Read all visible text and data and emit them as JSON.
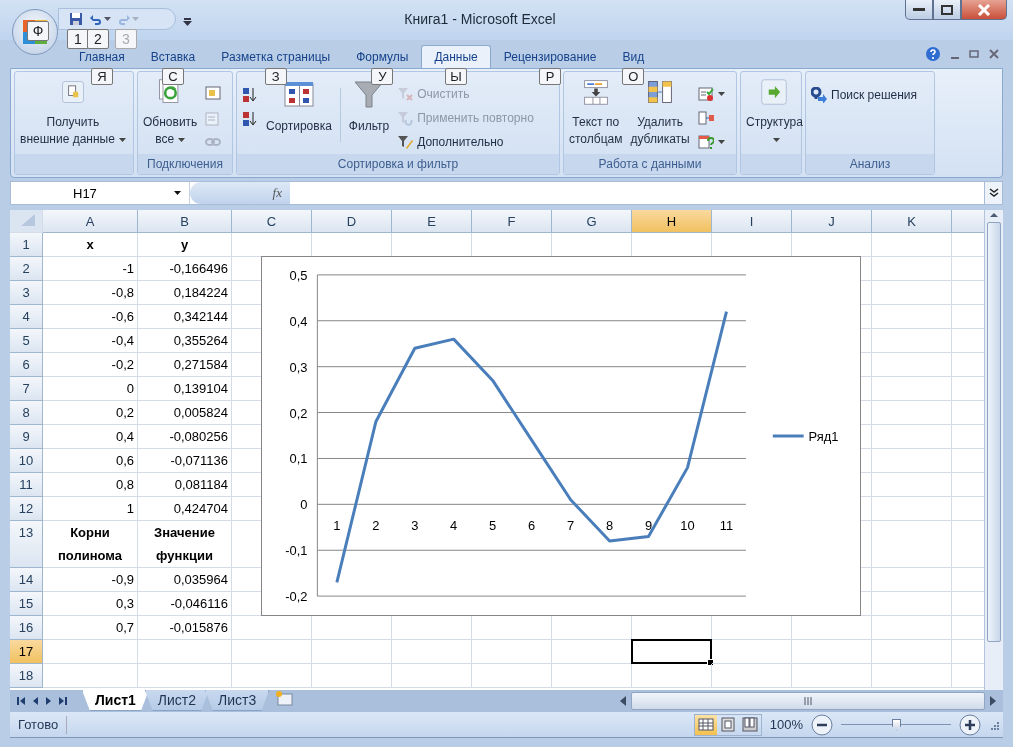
{
  "window": {
    "title": "Книга1 - Microsoft Excel"
  },
  "office_button": {
    "keytip": "Ф"
  },
  "quick_access": [
    {
      "keytip": "1",
      "disabled": false
    },
    {
      "keytip": "2",
      "disabled": false
    },
    {
      "keytip": "3",
      "disabled": true
    }
  ],
  "tabs": [
    {
      "label": "Главная",
      "keytip": "Я",
      "selected": false
    },
    {
      "label": "Вставка",
      "keytip": "С",
      "selected": false
    },
    {
      "label": "Разметка страницы",
      "keytip": "З",
      "selected": false
    },
    {
      "label": "Формулы",
      "keytip": "У",
      "selected": false
    },
    {
      "label": "Данные",
      "keytip": "Ы",
      "selected": true
    },
    {
      "label": "Рецензирование",
      "keytip": "Р",
      "selected": false
    },
    {
      "label": "Вид",
      "keytip": "О",
      "selected": false
    }
  ],
  "ribbon": {
    "groups": [
      {
        "items": [
          {
            "kind": "large",
            "label": "Получить\nвнешние данные",
            "dropdown": true,
            "disabled": false
          }
        ]
      },
      {
        "label": "Подключения",
        "items": [
          {
            "kind": "large",
            "label": "Обновить\nвсе",
            "dropdown": true,
            "disabled": false
          },
          {
            "kind": "small",
            "dropdown": false,
            "disabled": false
          },
          {
            "kind": "small",
            "dropdown": false,
            "disabled": true
          },
          {
            "kind": "small",
            "dropdown": false,
            "disabled": true
          }
        ]
      },
      {
        "label": "Сортировка и фильтр",
        "items": [
          {
            "kind": "small",
            "dropdown": false,
            "disabled": false
          },
          {
            "kind": "small",
            "dropdown": false,
            "disabled": false
          },
          {
            "kind": "large",
            "label": "Сортировка",
            "dropdown": false,
            "disabled": false
          },
          {
            "kind": "large",
            "label": "Фильтр",
            "dropdown": false,
            "disabled": false
          },
          {
            "kind": "small",
            "label": "Очистить",
            "dropdown": false,
            "disabled": true
          },
          {
            "kind": "small",
            "label": "Применить повторно",
            "dropdown": false,
            "disabled": true
          },
          {
            "kind": "small",
            "label": "Дополнительно",
            "dropdown": false,
            "disabled": false
          }
        ]
      },
      {
        "label": "Работа с данными",
        "items": [
          {
            "kind": "large",
            "label": "Текст по\nстолбцам",
            "dropdown": false,
            "disabled": false
          },
          {
            "kind": "large",
            "label": "Удалить\nдубликаты",
            "dropdown": false,
            "disabled": false
          },
          {
            "kind": "small",
            "dropdown": true,
            "disabled": false
          },
          {
            "kind": "small",
            "dropdown": false,
            "disabled": false
          },
          {
            "kind": "small",
            "dropdown": true,
            "disabled": false
          }
        ]
      },
      {
        "items": [
          {
            "kind": "large",
            "label": "Структура",
            "dropdown": true,
            "disabled": false
          }
        ]
      },
      {
        "label": "Анализ",
        "items": [
          {
            "kind": "small",
            "label": "Поиск решения",
            "dropdown": false,
            "disabled": false
          }
        ]
      }
    ]
  },
  "formula_bar": {
    "name_box": "H17",
    "function_button": "fx"
  },
  "sheet": {
    "columns": [
      {
        "label": "A",
        "selected": false
      },
      {
        "label": "B",
        "selected": false
      },
      {
        "label": "C",
        "selected": false
      },
      {
        "label": "D",
        "selected": false
      },
      {
        "label": "E",
        "selected": false
      },
      {
        "label": "F",
        "selected": false
      },
      {
        "label": "G",
        "selected": false
      },
      {
        "label": "H",
        "selected": true
      },
      {
        "label": "I",
        "selected": false
      },
      {
        "label": "J",
        "selected": false
      },
      {
        "label": "K",
        "selected": false
      }
    ],
    "rows": [
      {
        "label": "1",
        "kind": "header",
        "selected": false,
        "cells": [
          "x",
          "y"
        ]
      },
      {
        "label": "2",
        "kind": "data",
        "selected": false,
        "cells": [
          "-1",
          "-0,166496"
        ]
      },
      {
        "label": "3",
        "kind": "data",
        "selected": false,
        "cells": [
          "-0,8",
          "0,184224"
        ]
      },
      {
        "label": "4",
        "kind": "data",
        "selected": false,
        "cells": [
          "-0,6",
          "0,342144"
        ]
      },
      {
        "label": "5",
        "kind": "data",
        "selected": false,
        "cells": [
          "-0,4",
          "0,355264"
        ]
      },
      {
        "label": "6",
        "kind": "data",
        "selected": false,
        "cells": [
          "-0,2",
          "0,271584"
        ]
      },
      {
        "label": "7",
        "kind": "data",
        "selected": false,
        "cells": [
          "0",
          "0,139104"
        ]
      },
      {
        "label": "8",
        "kind": "data",
        "selected": false,
        "cells": [
          "0,2",
          "0,005824"
        ]
      },
      {
        "label": "9",
        "kind": "data",
        "selected": false,
        "cells": [
          "0,4",
          "-0,080256"
        ]
      },
      {
        "label": "10",
        "kind": "data",
        "selected": false,
        "cells": [
          "0,6",
          "-0,071136"
        ]
      },
      {
        "label": "11",
        "kind": "data",
        "selected": false,
        "cells": [
          "0,8",
          "0,081184"
        ]
      },
      {
        "label": "12",
        "kind": "data",
        "selected": false,
        "cells": [
          "1",
          "0,424704"
        ]
      },
      {
        "label": "13",
        "kind": "header",
        "selected": false,
        "cells": [
          "Корни полинома",
          "Значение функции"
        ]
      },
      {
        "label": "14",
        "kind": "data",
        "selected": false,
        "cells": [
          "-0,9",
          "0,035964"
        ]
      },
      {
        "label": "15",
        "kind": "data",
        "selected": false,
        "cells": [
          "0,3",
          "-0,046116"
        ]
      },
      {
        "label": "16",
        "kind": "data",
        "selected": false,
        "cells": [
          "0,7",
          "-0,015876"
        ]
      },
      {
        "label": "17",
        "selected": true,
        "cells": []
      },
      {
        "label": "18",
        "selected": false,
        "cells": []
      }
    ]
  },
  "chart": {
    "chart_data": {
      "type": "line",
      "categories": [
        "1",
        "2",
        "3",
        "4",
        "5",
        "6",
        "7",
        "8",
        "9",
        "10",
        "11"
      ],
      "series": [
        {
          "name": "Ряд1",
          "color": "#4a7ebb",
          "values": [
            -0.17,
            0.18,
            0.34,
            0.36,
            0.27,
            0.14,
            0.01,
            -0.08,
            -0.07,
            0.08,
            0.42
          ]
        }
      ],
      "ylim": [
        -0.2,
        0.5
      ],
      "grid": true,
      "yticks": [
        {
          "value": -0.2,
          "label": "-0,2"
        },
        {
          "value": -0.1,
          "label": "-0,1"
        },
        {
          "value": 0,
          "label": "0"
        },
        {
          "value": 0.1,
          "label": "0,1"
        },
        {
          "value": 0.2,
          "label": "0,2"
        },
        {
          "value": 0.3,
          "label": "0,3"
        },
        {
          "value": 0.4,
          "label": "0,4"
        },
        {
          "value": 0.5,
          "label": "0,5"
        }
      ]
    }
  },
  "sheet_tabs": [
    {
      "label": "Лист1",
      "selected": true
    },
    {
      "label": "Лист2",
      "selected": false
    },
    {
      "label": "Лист3",
      "selected": false
    }
  ],
  "status_bar": {
    "text": "Готово",
    "views": [
      {
        "selected": true
      },
      {
        "selected": false
      },
      {
        "selected": false
      }
    ],
    "zoom": "100%",
    "zoom_slider": {
      "level": 0.5
    }
  }
}
